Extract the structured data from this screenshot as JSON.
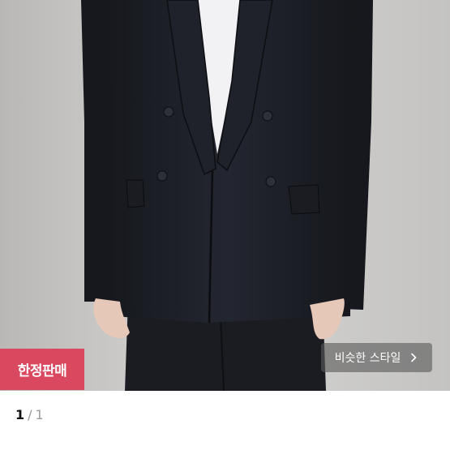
{
  "product": {
    "badge_label": "한정판매",
    "similar_style_label": "비슷한 스타일",
    "similar_style_icon": "chevron-right-icon"
  },
  "pager": {
    "current": "1",
    "separator": "/",
    "total": "1"
  },
  "colors": {
    "badge": "#d9485f",
    "background": "#c9c8c6",
    "jacket": "#1d2027"
  }
}
